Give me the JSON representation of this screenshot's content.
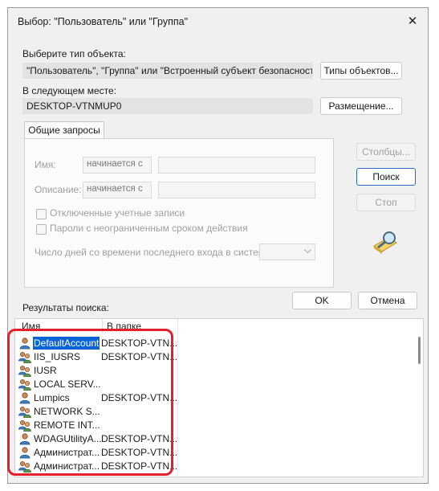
{
  "window": {
    "title": "Выбор: \"Пользователь\" или \"Группа\"",
    "close_glyph": "✕"
  },
  "object_type": {
    "label": "Выберите тип объекта:",
    "value": "\"Пользователь\", \"Группа\" или \"Встроенный субъект безопасности\"",
    "button": "Типы объектов..."
  },
  "location": {
    "label": "В следующем месте:",
    "value": "DESKTOP-VTNMUP0",
    "button": "Размещение..."
  },
  "tabs": {
    "common": "Общие запросы"
  },
  "query": {
    "name_label": "Имя:",
    "name_mode": "начинается с",
    "desc_label": "Описание:",
    "desc_mode": "начинается с",
    "disabled_accounts": "Отключенные учетные записи",
    "non_expiring": "Пароли с неограниченным сроком действия",
    "days_label": "Число дней со времени последнего входа в систему:"
  },
  "side_buttons": {
    "columns": "Столбцы...",
    "search": "Поиск",
    "stop": "Стоп"
  },
  "footer": {
    "results_label": "Результаты поиска:",
    "ok": "OK",
    "cancel": "Отмена"
  },
  "results": {
    "headers": {
      "name": "Имя",
      "folder": "В папке"
    },
    "rows": [
      {
        "name": "DefaultAccount",
        "folder": "DESKTOP-VTN...",
        "icon": "user-icon",
        "selected": true
      },
      {
        "name": "IIS_IUSRS",
        "folder": "DESKTOP-VTN...",
        "icon": "group-icon"
      },
      {
        "name": "IUSR",
        "folder": "",
        "icon": "group-icon"
      },
      {
        "name": "LOCAL SERV...",
        "folder": "",
        "icon": "group-icon"
      },
      {
        "name": "Lumpics",
        "folder": "DESKTOP-VTN...",
        "icon": "user-icon"
      },
      {
        "name": "NETWORK S...",
        "folder": "",
        "icon": "group-icon"
      },
      {
        "name": "REMOTE INT...",
        "folder": "",
        "icon": "group-icon"
      },
      {
        "name": "WDAGUtilityA...",
        "folder": "DESKTOP-VTN...",
        "icon": "user-icon"
      },
      {
        "name": "Администрат...",
        "folder": "DESKTOP-VTN...",
        "icon": "user-icon"
      },
      {
        "name": "Администрат...",
        "folder": "DESKTOP-VTN...",
        "icon": "group-icon"
      }
    ]
  },
  "colors": {
    "highlight": "#e5202a",
    "selection": "#0a64d8"
  }
}
